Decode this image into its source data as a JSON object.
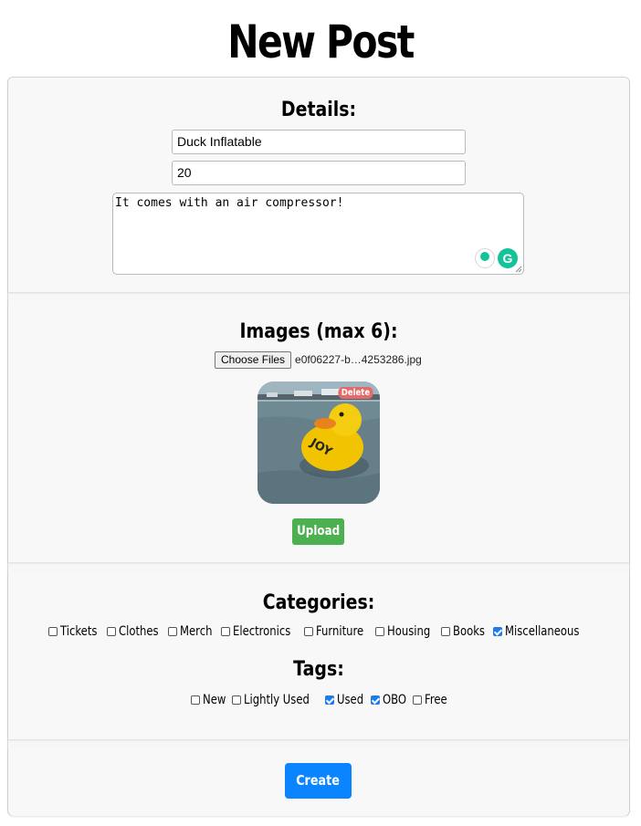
{
  "page": {
    "title": "New Post"
  },
  "details": {
    "heading": "Details:",
    "name_value": "Duck Inflatable",
    "price_value": "20",
    "description_value": "It comes with an air compressor!"
  },
  "images": {
    "heading": "Images (max 6):",
    "choose_label": "Choose Files",
    "file_name": "e0f06227-b…4253286.jpg",
    "delete_label": "Delete",
    "upload_label": "Upload"
  },
  "categories": {
    "heading": "Categories:",
    "items": [
      {
        "label": "Tickets",
        "checked": false
      },
      {
        "label": "Clothes",
        "checked": false
      },
      {
        "label": "Merch",
        "checked": false
      },
      {
        "label": "Electronics",
        "checked": false
      },
      {
        "label": "Furniture",
        "checked": false
      },
      {
        "label": "Housing",
        "checked": false
      },
      {
        "label": "Books",
        "checked": false
      },
      {
        "label": "Miscellaneous",
        "checked": true
      }
    ]
  },
  "tags": {
    "heading": "Tags:",
    "items": [
      {
        "label": "New",
        "checked": false
      },
      {
        "label": "Lightly Used",
        "checked": false
      },
      {
        "label": "Used",
        "checked": true
      },
      {
        "label": "OBO",
        "checked": true
      },
      {
        "label": "Free",
        "checked": false
      }
    ]
  },
  "actions": {
    "create_label": "Create"
  },
  "colors": {
    "upload_button": "#4caf50",
    "create_button": "#0a84ff",
    "delete_badge": "#e46a6a",
    "checkbox_checked": "#1e7ce8",
    "grammarly": "#15c39a"
  }
}
